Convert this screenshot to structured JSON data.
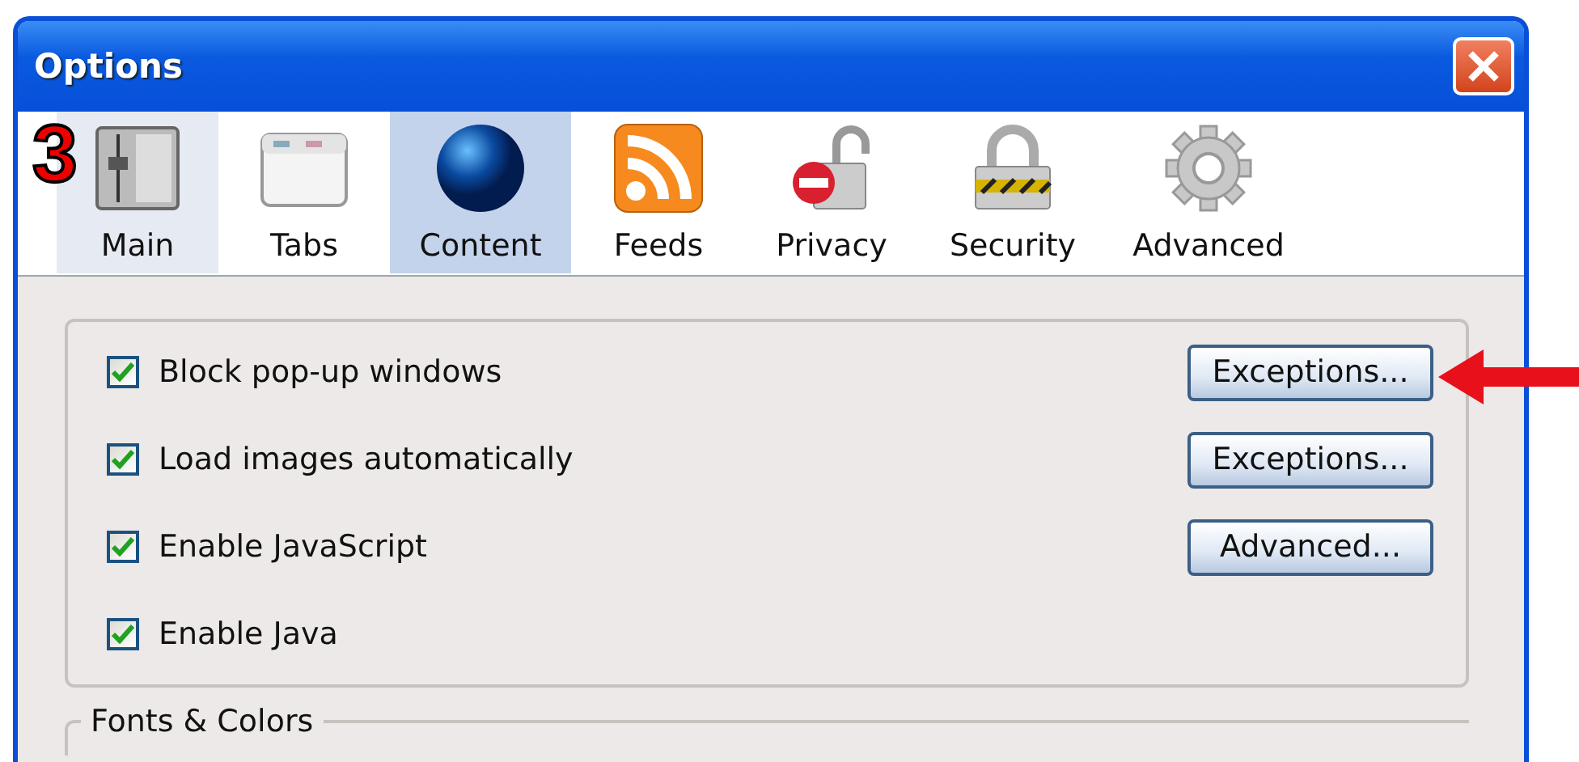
{
  "window": {
    "title": "Options"
  },
  "tabs": [
    {
      "label": "Main",
      "selected": false,
      "hovered": true,
      "kind": "main"
    },
    {
      "label": "Tabs",
      "selected": false,
      "hovered": false,
      "kind": "tabs"
    },
    {
      "label": "Content",
      "selected": true,
      "hovered": false,
      "kind": "content"
    },
    {
      "label": "Feeds",
      "selected": false,
      "hovered": false,
      "kind": "feeds"
    },
    {
      "label": "Privacy",
      "selected": false,
      "hovered": false,
      "kind": "privacy"
    },
    {
      "label": "Security",
      "selected": false,
      "hovered": false,
      "kind": "security"
    },
    {
      "label": "Advanced",
      "selected": false,
      "hovered": false,
      "kind": "advanced"
    }
  ],
  "options": [
    {
      "label": "Block pop-up windows",
      "checked": true,
      "button": {
        "label": "Exceptions..."
      }
    },
    {
      "label": "Load images automatically",
      "checked": true,
      "button": {
        "label": "Exceptions..."
      }
    },
    {
      "label": "Enable JavaScript",
      "checked": true,
      "button": {
        "label": "Advanced..."
      }
    },
    {
      "label": "Enable Java",
      "checked": true
    }
  ],
  "fonts_group": {
    "title": "Fonts & Colors"
  },
  "annotations": [
    {
      "kind": "step",
      "text": "3"
    },
    {
      "kind": "arrow"
    }
  ]
}
